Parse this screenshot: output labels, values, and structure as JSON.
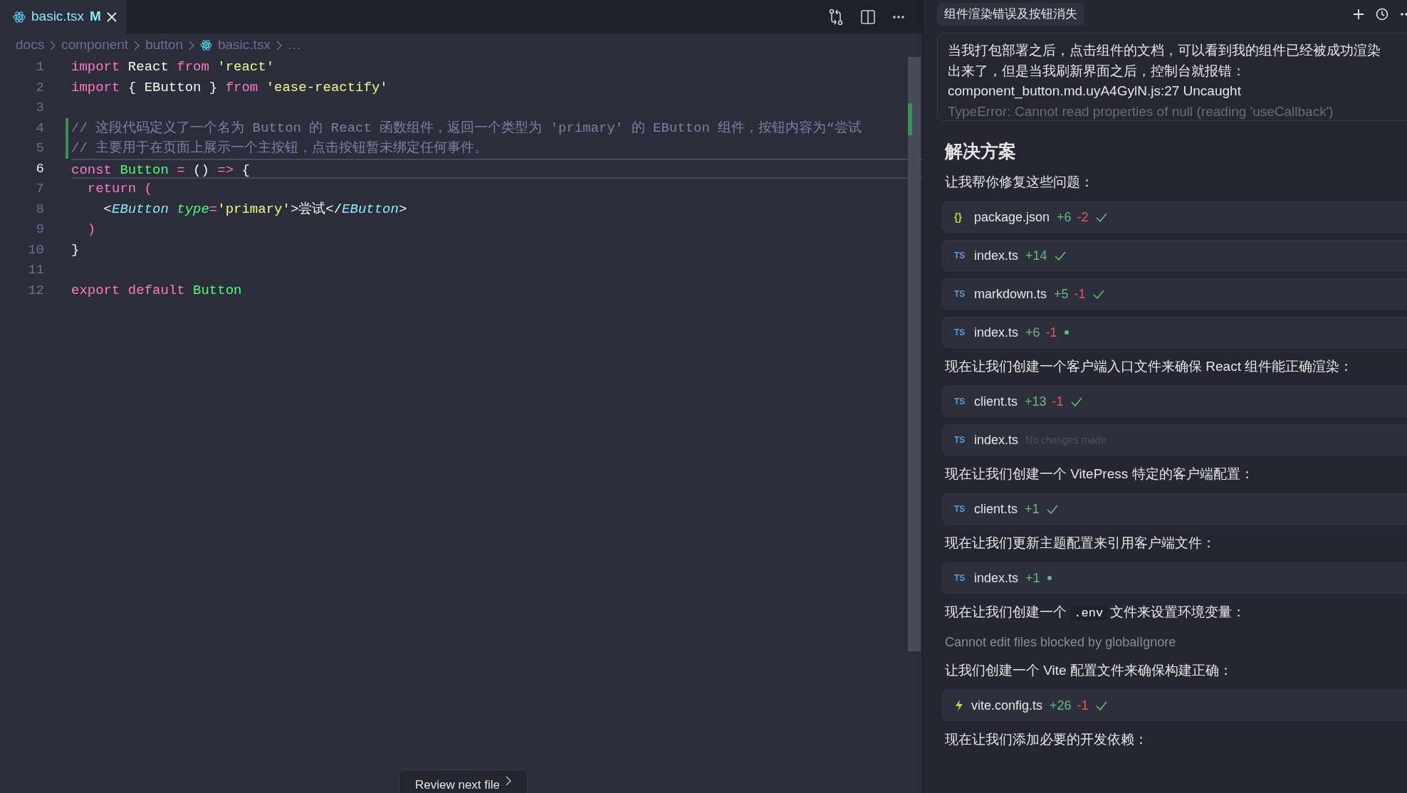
{
  "editor": {
    "tab": {
      "filename": "basic.tsx",
      "status": "M",
      "selected": true
    },
    "breadcrumb": [
      {
        "kind": "folder",
        "text": "docs"
      },
      {
        "kind": "folder",
        "text": "component"
      },
      {
        "kind": "folder",
        "text": "button"
      },
      {
        "kind": "file",
        "text": "basic.tsx"
      },
      {
        "kind": "more",
        "text": "…"
      }
    ],
    "lines": [
      {
        "number": "1",
        "active": false,
        "modified": false,
        "tokens": [
          {
            "kind": "kw",
            "text": "import"
          },
          {
            "kind": "plain",
            "text": " React "
          },
          {
            "kind": "kw",
            "text": "from"
          },
          {
            "kind": "str",
            "text": " 'react'"
          }
        ]
      },
      {
        "number": "2",
        "active": false,
        "modified": false,
        "tokens": [
          {
            "kind": "kw",
            "text": "import"
          },
          {
            "kind": "plain",
            "text": " { EButton } "
          },
          {
            "kind": "kw",
            "text": "from"
          },
          {
            "kind": "str",
            "text": " 'ease-reactify'"
          }
        ]
      },
      {
        "number": "3",
        "active": false,
        "modified": false
      },
      {
        "number": "4",
        "active": false,
        "modified": true,
        "tokens": [
          {
            "kind": "comment",
            "text": "// 这段代码定义了一个名为 Button 的 React 函数组件，返回一个类型为 'primary' 的 EButton 组件，按钮内容为“尝试"
          }
        ]
      },
      {
        "number": "5",
        "active": false,
        "modified": true,
        "tokens": [
          {
            "kind": "comment",
            "text": "// 主要用于在页面上展示一个主按钮，点击按钮暂未绑定任何事件。"
          }
        ]
      },
      {
        "number": "6",
        "active": true,
        "modified": false,
        "tokens": [
          {
            "kind": "kw",
            "text": "const"
          },
          {
            "kind": "fn",
            "text": " Button"
          },
          {
            "kind": "op",
            "text": " ="
          },
          {
            "kind": "plain",
            "text": " () "
          },
          {
            "kind": "op",
            "text": "=>"
          },
          {
            "kind": "plain",
            "text": " {"
          }
        ]
      },
      {
        "number": "7",
        "active": false,
        "modified": false,
        "tokens": [
          {
            "kind": "kw",
            "text": "  return"
          },
          {
            "kind": "op",
            "text": " ("
          }
        ]
      },
      {
        "number": "8",
        "active": false,
        "modified": false,
        "tokens": [
          {
            "kind": "plain",
            "text": "    <"
          },
          {
            "kind": "tag",
            "text": "EButton"
          },
          {
            "kind": "attr",
            "text": " type"
          },
          {
            "kind": "op",
            "text": "="
          },
          {
            "kind": "str",
            "text": "'primary'"
          },
          {
            "kind": "plain",
            "text": ">尝试</"
          },
          {
            "kind": "tag",
            "text": "EButton"
          },
          {
            "kind": "plain",
            "text": ">"
          }
        ]
      },
      {
        "number": "9",
        "active": false,
        "modified": false,
        "tokens": [
          {
            "kind": "op",
            "text": "  )"
          }
        ]
      },
      {
        "number": "10",
        "active": false,
        "modified": false,
        "tokens": [
          {
            "kind": "plain",
            "text": "}"
          }
        ]
      },
      {
        "number": "11",
        "active": false,
        "modified": false
      },
      {
        "number": "12",
        "active": false,
        "modified": false,
        "tokens": [
          {
            "kind": "kw",
            "text": "export"
          },
          {
            "kind": "kw",
            "text": " default"
          },
          {
            "kind": "fn",
            "text": " Button"
          }
        ]
      }
    ],
    "review_button": "Review next file"
  },
  "chat": {
    "title": "组件渲染错误及按钮消失",
    "prompt_lines": [
      "当我打包部署之后，点击组件的文档，可以看到我的组件已经被成功渲染",
      "出来了，但是当我刷新界面之后，控制台就报错：",
      "component_button.md.uyA4GylN.js:27 Uncaught",
      "TypeError: Cannot read properties of null (reading 'useCallback')"
    ],
    "messages": [
      {
        "kind": "heading",
        "text": "解决方案"
      },
      {
        "kind": "text",
        "segments": [
          {
            "kind": "plain",
            "text": "让我帮你修复这些问题："
          }
        ]
      },
      {
        "kind": "jsonfile",
        "icon_text": "{}",
        "name": "package.json",
        "added": "+6",
        "removed": "-2",
        "done": true
      },
      {
        "kind": "tsfile",
        "icon_text": "TS",
        "name": "index.ts",
        "added": "+14",
        "done": true
      },
      {
        "kind": "tsfile",
        "icon_text": "TS",
        "name": "markdown.ts",
        "added": "+5",
        "removed": "-1",
        "done": true
      },
      {
        "kind": "tsfile",
        "icon_text": "TS",
        "name": "index.ts",
        "added": "+6",
        "removed": "-1",
        "done": false
      },
      {
        "kind": "text",
        "segments": [
          {
            "kind": "plain",
            "text": "现在让我们创建一个客户端入口文件来确保 React 组件能正确渲染："
          }
        ]
      },
      {
        "kind": "tsfile",
        "icon_text": "TS",
        "name": "client.ts",
        "added": "+13",
        "removed": "-1",
        "done": true
      },
      {
        "kind": "tsfile",
        "icon_text": "TS",
        "name": "index.ts",
        "note": "No changes made"
      },
      {
        "kind": "text",
        "segments": [
          {
            "kind": "plain",
            "text": "现在让我们创建一个 VitePress 特定的客户端配置："
          }
        ]
      },
      {
        "kind": "tsfile",
        "icon_text": "TS",
        "name": "client.ts",
        "added": "+1",
        "done": true
      },
      {
        "kind": "text",
        "segments": [
          {
            "kind": "plain",
            "text": "现在让我们更新主题配置来引用客户端文件："
          }
        ]
      },
      {
        "kind": "tsfile",
        "icon_text": "TS",
        "name": "index.ts",
        "added": "+1",
        "done": false
      },
      {
        "kind": "text",
        "segments": [
          {
            "kind": "plain",
            "text": "现在让我们创建一个 "
          },
          {
            "kind": "code",
            "text": ".env"
          },
          {
            "kind": "plain",
            "text": " 文件来设置环境变量："
          }
        ]
      },
      {
        "kind": "muted",
        "text": "Cannot edit files blocked by globalIgnore"
      },
      {
        "kind": "text",
        "segments": [
          {
            "kind": "plain",
            "text": "让我们创建一个 Vite 配置文件来确保构建正确："
          }
        ]
      },
      {
        "kind": "vitefile",
        "name": "vite.config.ts",
        "added": "+26",
        "removed": "-1",
        "done": true
      },
      {
        "kind": "text",
        "segments": [
          {
            "kind": "plain",
            "text": "现在让我们添加必要的开发依赖："
          }
        ]
      }
    ]
  }
}
